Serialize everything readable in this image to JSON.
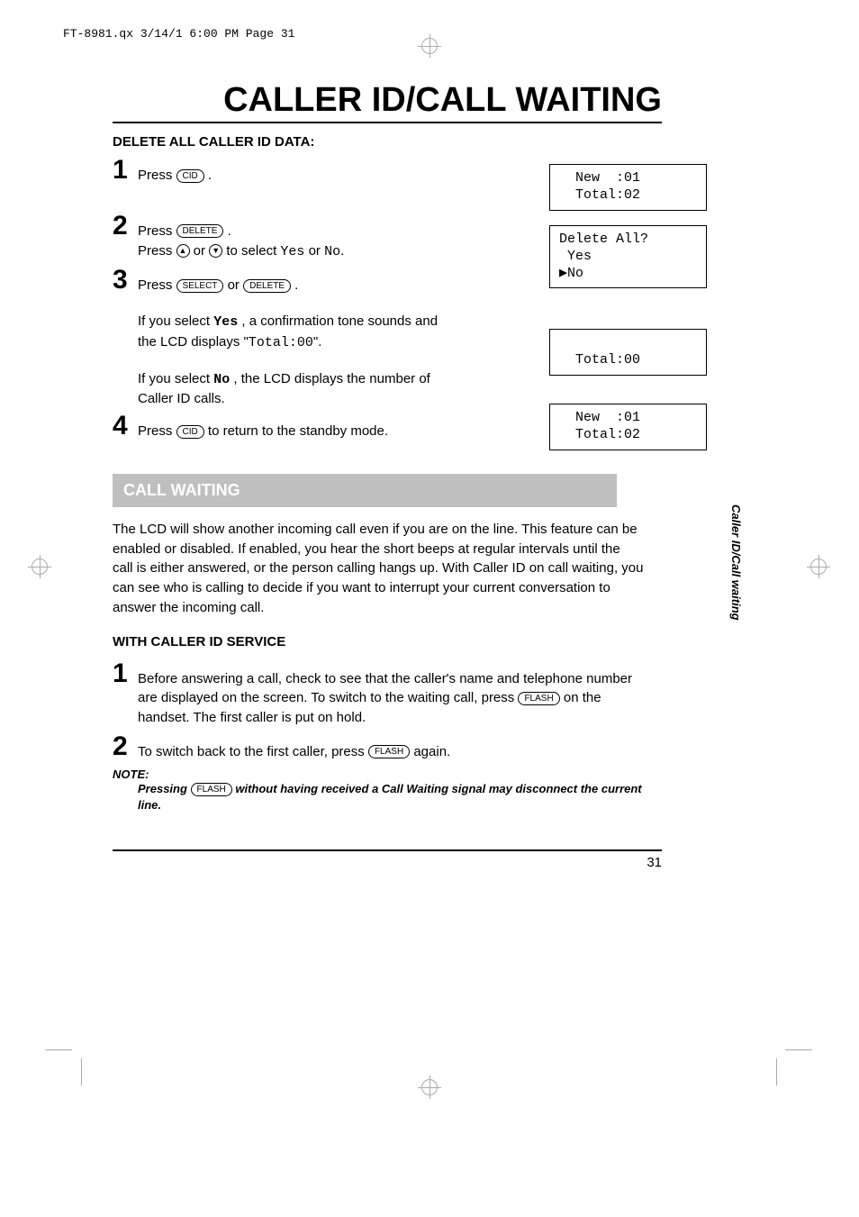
{
  "header": {
    "slug": "FT-8981.qx  3/14/1  6:00 PM  Page 31"
  },
  "title": "CALLER ID/CALL WAITING",
  "section1": {
    "heading": "DELETE ALL CALLER ID DATA:",
    "steps": {
      "s1": {
        "num": "1",
        "text_a": "Press ",
        "btn1": "CID",
        "text_b": " ."
      },
      "s2": {
        "num": "2",
        "line1_a": "Press ",
        "line1_btn": "DELETE",
        "line1_b": " .",
        "line2_a": "Press ",
        "line2_btnUp": "▲",
        "line2_mid": " or ",
        "line2_btnDn": "▼",
        "line2_b": " to select ",
        "line2_yes": "Yes",
        "line2_or": " or ",
        "line2_no": "No",
        "line2_end": "."
      },
      "s3": {
        "num": "3",
        "line1_a": "Press ",
        "line1_btn1": "SELECT",
        "line1_mid": " or ",
        "line1_btn2": "DELETE",
        "line1_b": " .",
        "yes_a": "If you select ",
        "yes_val": "Yes",
        "yes_b": " , a confirmation tone sounds and the LCD displays \"",
        "yes_lcd": "Total:00",
        "yes_c": "\".",
        "no_a": "If you select ",
        "no_val": "No",
        "no_b": " , the LCD displays the number of Caller ID calls."
      },
      "s4": {
        "num": "4",
        "text_a": "Press ",
        "btn1": "CID",
        "text_b": " to return to the standby mode."
      }
    },
    "lcd1": "  New  :01\n  Total:02",
    "lcd2": "Delete All?\n Yes\n▶No",
    "lcd3": "\n  Total:00",
    "lcd4": "  New  :01\n  Total:02"
  },
  "section2": {
    "bar": "CALL WAITING",
    "para": "The LCD will show another incoming call even if you are on the line. This feature can be enabled or disabled.  If enabled, you hear the short beeps at regular intervals until the call is either answered, or the person calling hangs up.  With Caller ID on call waiting, you can see who is calling to decide if you want to interrupt your current conversation to answer the incoming call.",
    "subhead": "WITH CALLER ID SERVICE",
    "s1": {
      "num": "1",
      "a": "Before answering a call, check to see that the caller's name and telephone number are displayed on the screen.  To switch to the waiting call, press ",
      "btn": "FLASH",
      "b": " on the handset.  The first caller is put on hold."
    },
    "s2": {
      "num": "2",
      "a": "To switch back to the first caller, press ",
      "btn": "FLASH",
      "b": " again."
    },
    "note_label": "NOTE:",
    "note_a": "Pressing ",
    "note_btn": "FLASH",
    "note_b": " without having received a Call Waiting signal may disconnect the current line."
  },
  "sidetab": "Caller ID/Call waiting",
  "pagenum": "31"
}
